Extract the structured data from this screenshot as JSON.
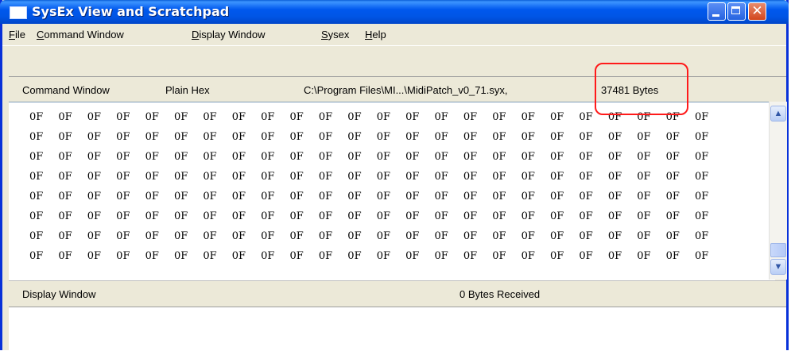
{
  "window": {
    "title": "SysEx View and Scratchpad"
  },
  "menu": [
    {
      "mnemonic": "F",
      "rest": "ile"
    },
    {
      "mnemonic": "C",
      "rest": "ommand Window"
    },
    {
      "mnemonic": "D",
      "rest": "isplay Window"
    },
    {
      "mnemonic": "S",
      "rest": "ysex"
    },
    {
      "mnemonic": "H",
      "rest": "elp"
    }
  ],
  "command_header": {
    "title": "Command Window",
    "mode": "Plain Hex",
    "file_path": "C:\\Program Files\\MI...\\MidiPatch_v0_71.syx,",
    "byte_count": "37481 Bytes"
  },
  "hex_view": {
    "byte_value": "0F",
    "columns": 24,
    "rows": 8
  },
  "display_header": {
    "title": "Display Window",
    "received": "0  Bytes Received"
  },
  "colors": {
    "titlebar": "#0058EE",
    "chrome": "#ECE9D8",
    "highlight": "#FF1A1A"
  }
}
